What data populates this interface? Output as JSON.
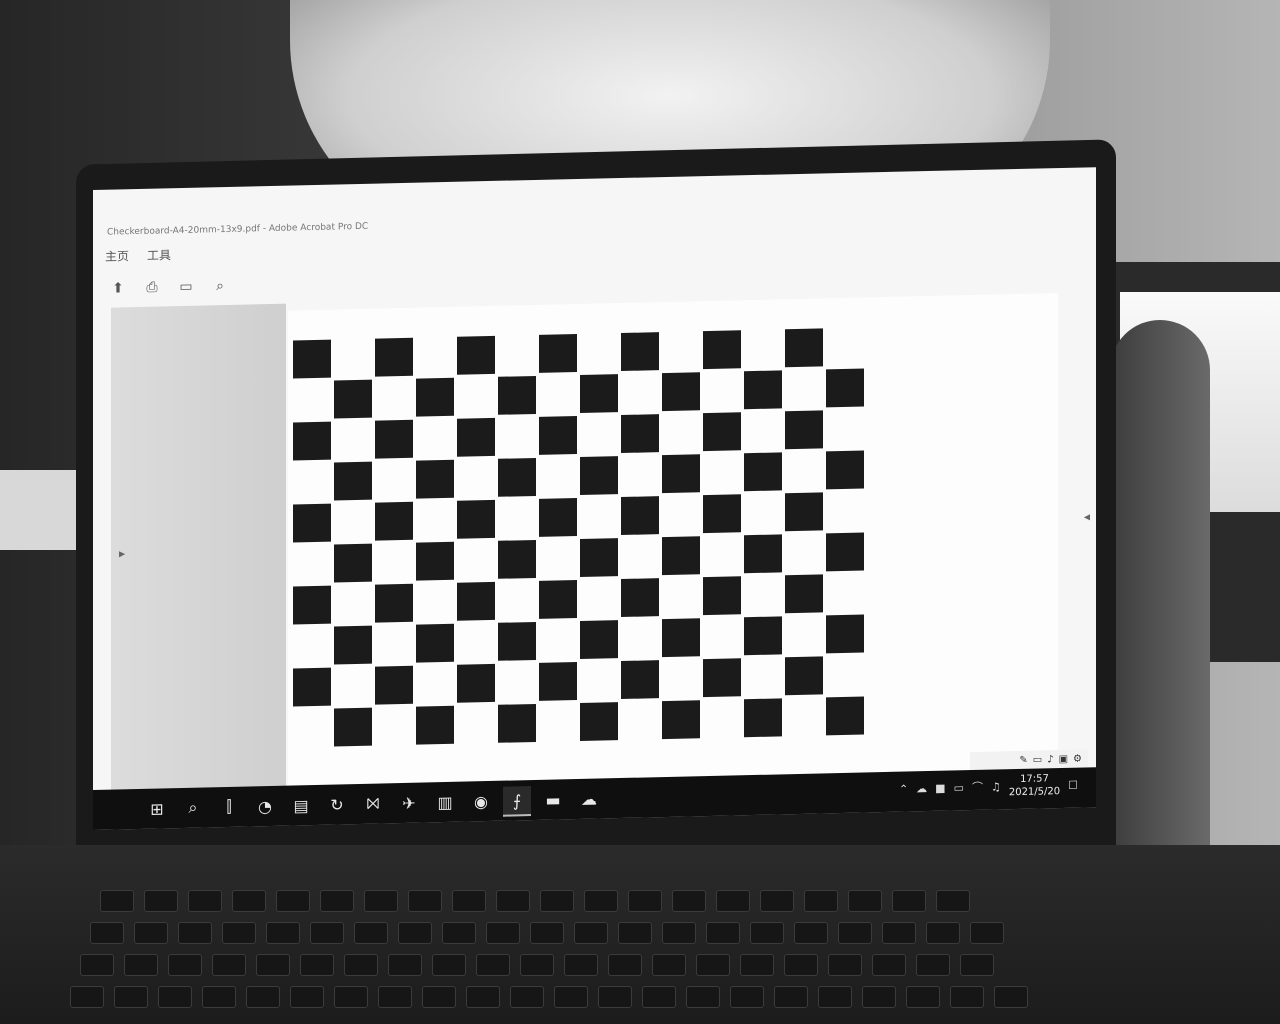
{
  "window": {
    "title": "Checkerboard-A4-20mm-13x9.pdf - Adobe Acrobat Pro DC"
  },
  "menu": {
    "items": [
      "主页",
      "工具"
    ]
  },
  "toolbar": {
    "icons": [
      "upload-icon",
      "print-icon",
      "page-view-icon",
      "search-icon"
    ]
  },
  "document": {
    "checkerboard": {
      "rows": 10,
      "cols": 14,
      "square_color": "#1b1b1b",
      "paper_color": "#fdfdfd"
    }
  },
  "taskbar": {
    "apps": [
      "windows-start-icon",
      "search-icon",
      "task-view-icon",
      "edge-icon",
      "file-explorer-icon",
      "refresh-app-icon",
      "visual-studio-icon",
      "plane-app-icon",
      "document-app-icon",
      "camera-app-icon",
      "acrobat-icon",
      "terminal-icon",
      "wechat-icon"
    ],
    "active_app": "acrobat-icon",
    "time": "17:57",
    "date": "2021/5/20"
  }
}
